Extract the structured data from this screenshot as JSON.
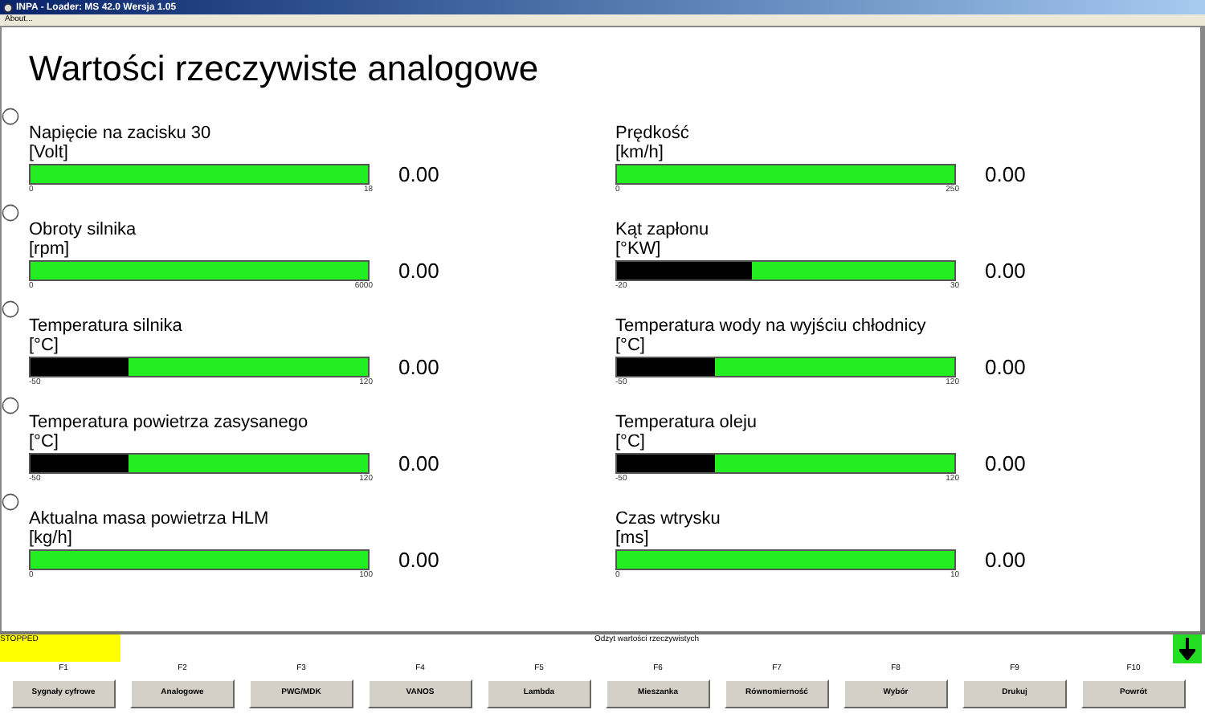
{
  "window": {
    "title": "INPA - Loader: MS 42.0 Wersja 1.05"
  },
  "menu": [
    "About..."
  ],
  "title": "Wartości rzeczywiste analogowe",
  "rows": [
    {
      "gauges": [
        {
          "label": "Napięcie na zacisku 30",
          "unit": "[Volt]",
          "level": 1,
          "value": "0.00",
          "min": "0",
          "max": "18"
        },
        {
          "label": "Prędkość",
          "unit": "[km/h]",
          "level": 1,
          "value": "0.00",
          "min": "0",
          "max": "250"
        }
      ]
    },
    {
      "gauges": [
        {
          "label": "Obroty silnika",
          "unit": "[rpm]",
          "level": 1,
          "value": "0.00",
          "min": "0",
          "max": "6000"
        },
        {
          "label": "Kąt zapłonu",
          "unit": "[°KW]",
          "level": 0.6,
          "value": "0.00",
          "min": "-20",
          "max": "30"
        }
      ]
    },
    {
      "gauges": [
        {
          "label": "Temperatura silnika",
          "unit": "[°C]",
          "level": 0.71,
          "value": "0.00",
          "min": "-50",
          "max": "120"
        },
        {
          "label": "Temperatura wody na wyjściu chłodnicy",
          "unit": "[°C]",
          "level": 0.71,
          "value": "0.00",
          "min": "-50",
          "max": "120"
        }
      ]
    },
    {
      "gauges": [
        {
          "label": "Temperatura powietrza zasysanego",
          "unit": "[°C]",
          "level": 0.71,
          "value": "0.00",
          "min": "-50",
          "max": "120"
        },
        {
          "label": "Temperatura oleju",
          "unit": "[°C]",
          "level": 0.71,
          "value": "0.00",
          "min": "-50",
          "max": "120"
        }
      ]
    },
    {
      "gauges": [
        {
          "label": "Aktualna masa powietrza HLM",
          "unit": "[kg/h]",
          "level": 1,
          "value": "0.00",
          "min": "0",
          "max": "100"
        },
        {
          "label": "Czas wtrysku",
          "unit": "[ms]",
          "level": 1,
          "value": "0.00",
          "min": "0",
          "max": "10"
        }
      ]
    }
  ],
  "status": {
    "state": "STOPPED",
    "message": "Odzyt wartości rzeczywistych"
  },
  "function_keys": [
    {
      "key": "F1",
      "label": "Sygnały cyfrowe"
    },
    {
      "key": "F2",
      "label": "Analogowe"
    },
    {
      "key": "F3",
      "label": "PWG/MDK"
    },
    {
      "key": "F4",
      "label": "VANOS"
    },
    {
      "key": "F5",
      "label": "Lambda"
    },
    {
      "key": "F6",
      "label": "Mieszanka"
    },
    {
      "key": "F7",
      "label": "Równomierność"
    },
    {
      "key": "F8",
      "label": "Wybór"
    },
    {
      "key": "F9",
      "label": "Drukuj"
    },
    {
      "key": "F10",
      "label": "Powrót"
    }
  ]
}
